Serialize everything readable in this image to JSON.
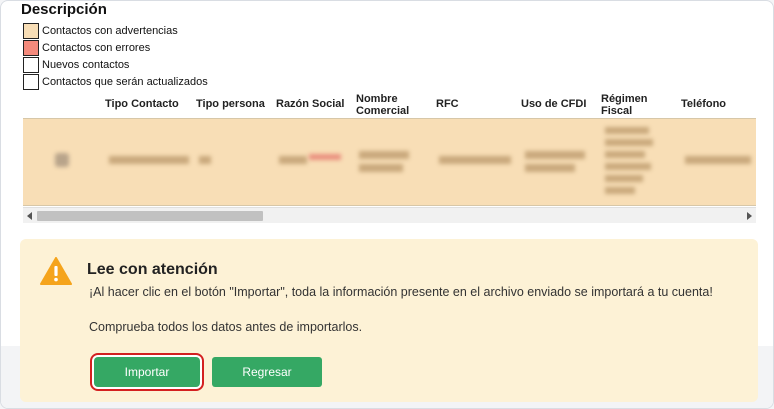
{
  "section_title": "Descripción",
  "legend": [
    {
      "label": "Contactos con advertencias",
      "color": "#f8deb6"
    },
    {
      "label": "Contactos con errores",
      "color": "#f48a7c"
    },
    {
      "label": "Nuevos contactos",
      "color": "#ffffff"
    },
    {
      "label": "Contactos que serán actualizados",
      "color": "#ffffff"
    }
  ],
  "table": {
    "headers": {
      "tipo_contacto": "Tipo Contacto",
      "tipo_persona": "Tipo persona",
      "razon_social": "Razón Social",
      "nombre_comercial": "Nombre Comercial",
      "rfc": "RFC",
      "uso_cfdi": "Uso de CFDI",
      "regimen_fiscal": "Régimen Fiscal",
      "telefono": "Teléfono"
    }
  },
  "alert": {
    "title": "Lee con atención",
    "message": "¡Al hacer clic en el botón \"Importar\", toda la información presente en el archivo enviado se importará a tu cuenta!",
    "message2": "Comprueba todos los datos antes de importarlos.",
    "import_label": "Importar",
    "back_label": "Regresar"
  },
  "colors": {
    "accent_green": "#35a864",
    "warning_bg": "#fdf2d6",
    "highlight_red": "#d42020"
  },
  "icons": {
    "warning": "warning-triangle-icon"
  }
}
